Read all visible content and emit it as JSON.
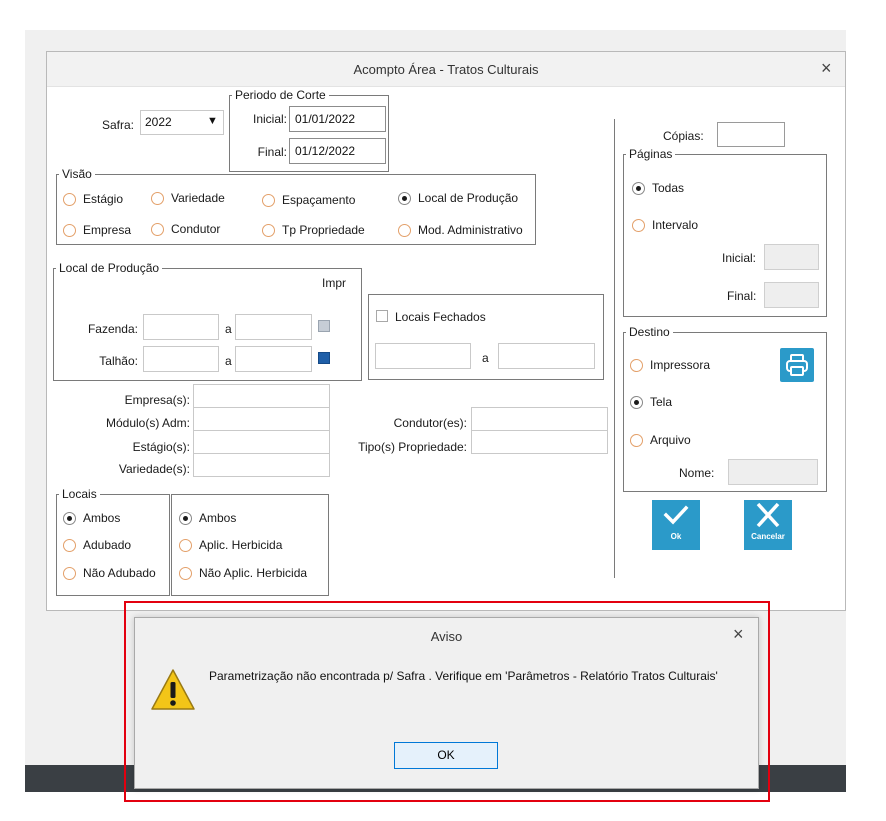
{
  "window": {
    "title": "Acompto Área - Tratos Culturais",
    "close_label": "×"
  },
  "safra": {
    "label": "Safra:",
    "value": "2022",
    "arrow": "▼"
  },
  "periodo": {
    "title": "Periodo de Corte",
    "inicial_label": "Inicial:",
    "inicial_value": "01/01/2022",
    "final_label": "Final:",
    "final_value": "01/12/2022"
  },
  "visao": {
    "title": "Visão",
    "options": [
      "Estágio",
      "Variedade",
      "Espaçamento",
      "Local de Produção",
      "Empresa",
      "Condutor",
      "Tp Propriedade",
      "Mod. Administrativo"
    ],
    "selected": "Local de Produção"
  },
  "local_producao": {
    "title": "Local de Produção",
    "impr_label": "Impr",
    "fazenda_label": "Fazenda:",
    "talhao_label": "Talhão:",
    "a_label": "a"
  },
  "locais_fechados": {
    "label": "Locais Fechados",
    "a_label": "a"
  },
  "filtros": {
    "empresa_label": "Empresa(s):",
    "modulo_label": "Módulo(s) Adm:",
    "estagio_label": "Estágio(s):",
    "variedade_label": "Variedade(s):",
    "condutor_label": "Condutor(es):",
    "tipo_label": "Tipo(s) Propriedade:"
  },
  "locais": {
    "title": "Locais",
    "options_a": [
      "Ambos",
      "Adubado",
      "Não Adubado"
    ],
    "options_b": [
      "Ambos",
      "Aplic. Herbicida",
      "Não Aplic. Herbicida"
    ],
    "selected_a": "Ambos",
    "selected_b": "Ambos"
  },
  "copias": {
    "label": "Cópias:",
    "value": ""
  },
  "paginas": {
    "title": "Páginas",
    "todas_label": "Todas",
    "intervalo_label": "Intervalo",
    "inicial_label": "Inicial:",
    "final_label": "Final:",
    "selected": "Todas"
  },
  "destino": {
    "title": "Destino",
    "impressora_label": "Impressora",
    "tela_label": "Tela",
    "arquivo_label": "Arquivo",
    "nome_label": "Nome:",
    "selected": "Tela"
  },
  "actions": {
    "ok_label": "Ok",
    "cancelar_label": "Cancelar"
  },
  "dialog": {
    "title": "Aviso",
    "close_label": "×",
    "message": "Parametrização não encontrada p/ Safra . Verifique em 'Parâmetros - Relatório Tratos Culturais'",
    "ok_label": "OK"
  },
  "colors": {
    "accent": "#2b9ac9",
    "highlight_border": "#e3000f",
    "checkbox_dark": "#1f5fa8"
  },
  "icons": [
    "close-icon",
    "dropdown-arrow-icon",
    "printer-icon",
    "checkmark-icon",
    "cancel-x-icon",
    "warning-icon"
  ]
}
